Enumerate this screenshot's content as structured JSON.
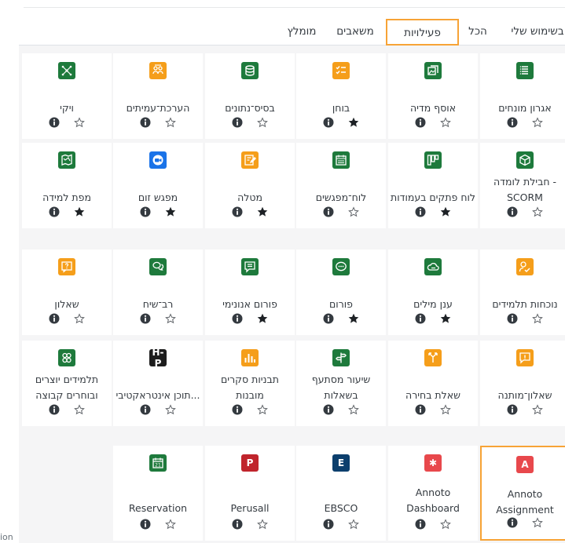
{
  "tabs": [
    {
      "label": "בשימוש שלי",
      "active": false
    },
    {
      "label": "הכל",
      "active": false
    },
    {
      "label": "פעילויות",
      "active": true
    },
    {
      "label": "משאבים",
      "active": false
    },
    {
      "label": "מומלץ",
      "active": false
    }
  ],
  "rows": [
    [
      {
        "name": "אגרון מונחים",
        "icon": "glossary-icon",
        "color": "green",
        "starred": false
      },
      {
        "name": "אוסף מדיה",
        "icon": "media-collection-icon",
        "color": "green",
        "starred": false
      },
      {
        "name": "בוחן",
        "icon": "quiz-icon",
        "color": "orange",
        "starred": true
      },
      {
        "name": "בסיס־נתונים",
        "icon": "database-icon",
        "color": "green",
        "starred": false
      },
      {
        "name": "הערכת־עמיתים",
        "icon": "workshop-icon",
        "color": "orange",
        "starred": false
      },
      {
        "name": "ויקי",
        "icon": "wiki-icon",
        "color": "green",
        "starred": false
      }
    ],
    [
      {
        "name": "חבילת לומדה - SCORM",
        "icon": "scorm-icon",
        "color": "green",
        "starred": false
      },
      {
        "name": "לוח פתקים בעמודות",
        "icon": "kanban-icon",
        "color": "green",
        "starred": true
      },
      {
        "name": "לוח־מפגשים",
        "icon": "scheduler-icon",
        "color": "green",
        "starred": false
      },
      {
        "name": "מטלה",
        "icon": "assignment-icon",
        "color": "orange",
        "starred": true
      },
      {
        "name": "מפגש זום",
        "icon": "zoom-icon",
        "color": "blue",
        "starred": true
      },
      {
        "name": "מפת למידה",
        "icon": "learning-map-icon",
        "color": "green",
        "starred": true
      }
    ],
    [
      {
        "name": "נוכחות תלמידים",
        "icon": "attendance-icon",
        "color": "orange",
        "starred": false
      },
      {
        "name": "ענן מילים",
        "icon": "word-cloud-icon",
        "color": "green",
        "starred": true
      },
      {
        "name": "פורום",
        "icon": "forum-icon",
        "color": "green",
        "starred": true
      },
      {
        "name": "פורום אנונימי",
        "icon": "anonymous-forum-icon",
        "color": "green",
        "starred": true
      },
      {
        "name": "רב־שיח",
        "icon": "chat-icon",
        "color": "green",
        "starred": false
      },
      {
        "name": "שאלון",
        "icon": "questionnaire-icon",
        "color": "orange",
        "starred": false
      }
    ],
    [
      {
        "name": "שאלון־מותנה",
        "icon": "feedback-icon",
        "color": "orange",
        "starred": false
      },
      {
        "name": "שאלת בחירה",
        "icon": "choice-icon",
        "color": "orange",
        "starred": false
      },
      {
        "name": "שיעור מסתעף בשאלות",
        "icon": "lesson-icon",
        "color": "green",
        "starred": false
      },
      {
        "name": "תבניות סקרים מובנות",
        "icon": "survey-icon",
        "color": "orange",
        "starred": false
      },
      {
        "name": "תוכן אינטראקטיבי...",
        "icon": "h5p-icon",
        "color": "black",
        "iconText": "H-P",
        "starred": false
      },
      {
        "name": "תלמידים יוצרים ובוחרים קבוצה",
        "icon": "group-choice-icon",
        "color": "green",
        "starred": false
      }
    ],
    [
      {
        "name": "Annoto Assignment",
        "icon": "annoto-assignment-icon",
        "color": "pink",
        "iconText": "A",
        "starred": false,
        "selected": true
      },
      {
        "name": "Annoto Dashboard",
        "icon": "annoto-dashboard-icon",
        "color": "pink",
        "iconText": "✱",
        "starred": false
      },
      {
        "name": "EBSCO",
        "icon": "ebsco-icon",
        "color": "navy",
        "iconText": "E",
        "starred": false
      },
      {
        "name": "Perusall",
        "icon": "perusall-icon",
        "color": "red",
        "iconText": "P",
        "starred": false
      },
      {
        "name": "Reservation",
        "icon": "reservation-icon",
        "color": "green",
        "starred": false
      }
    ]
  ],
  "colors": {
    "green": "#1e7a3c",
    "orange": "#f59e1a",
    "blue": "#1a73e8",
    "black": "#1d1d1d",
    "red": "#c0242c",
    "navy": "#0c3f6d",
    "pink": "#e8484c",
    "accent": "#f7a336"
  },
  "action_icons": {
    "info": "info-icon",
    "star_empty": "star-outline-icon",
    "star_filled": "star-filled-icon"
  },
  "cutoff_text": "ion"
}
